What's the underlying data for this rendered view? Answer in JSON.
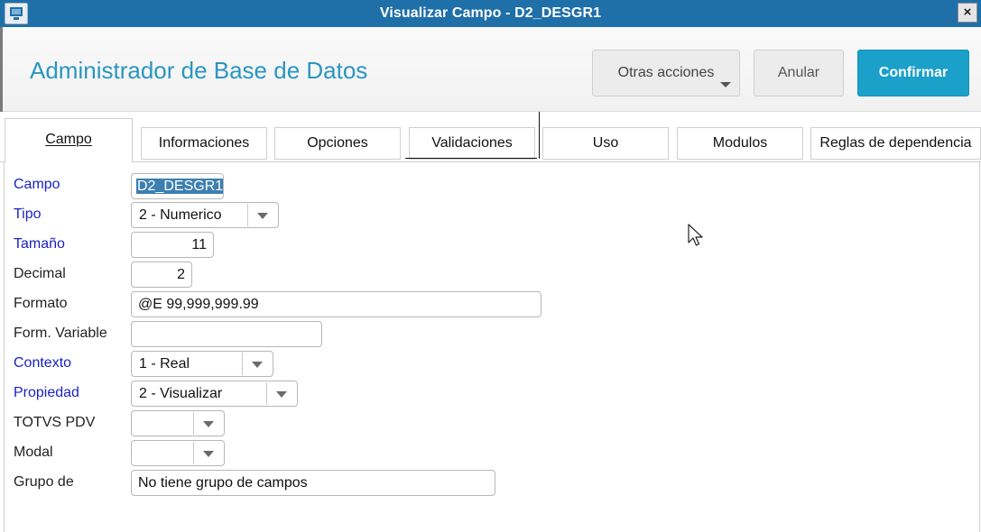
{
  "window": {
    "title": "Visualizar Campo - D2_DESGR1",
    "close_glyph": "×"
  },
  "header": {
    "title": "Administrador de Base de Datos",
    "more_actions_label": "Otras acciones",
    "cancel_label": "Anular",
    "confirm_label": "Confirmar"
  },
  "tabs": [
    {
      "label": "Campo",
      "active": true
    },
    {
      "label": "Informaciones",
      "active": false
    },
    {
      "label": "Opciones",
      "active": false
    },
    {
      "label": "Validaciones",
      "active": false
    },
    {
      "label": "Uso",
      "active": false
    },
    {
      "label": "Modulos",
      "active": false
    },
    {
      "label": "Reglas de dependencia",
      "active": false
    }
  ],
  "form": {
    "campo": {
      "label": "Campo",
      "value": "D2_DESGR1"
    },
    "tipo": {
      "label": "Tipo",
      "value": "2 - Numerico"
    },
    "tamano": {
      "label": "Tamaño",
      "value": "11"
    },
    "decimal": {
      "label": "Decimal",
      "value": "2"
    },
    "formato": {
      "label": "Formato",
      "value": "@E 99,999,999.99"
    },
    "form_variable": {
      "label": "Form. Variable",
      "value": ""
    },
    "contexto": {
      "label": "Contexto",
      "value": "1 - Real"
    },
    "propiedad": {
      "label": "Propiedad",
      "value": "2 - Visualizar"
    },
    "totvs_pdv": {
      "label": "TOTVS PDV",
      "value": ""
    },
    "modal": {
      "label": "Modal",
      "value": ""
    },
    "grupo_de": {
      "label": "Grupo de",
      "value": "No tiene grupo de campos"
    }
  },
  "colors": {
    "titlebar": "#1f6fa8",
    "accent": "#2a96bf",
    "confirm_button": "#1ba0c9",
    "required_label": "#1a22c2"
  },
  "icons": {
    "app": "monitor-icon",
    "close": "close-icon",
    "dropdown": "chevron-down-icon",
    "cursor": "mouse-pointer-icon"
  }
}
